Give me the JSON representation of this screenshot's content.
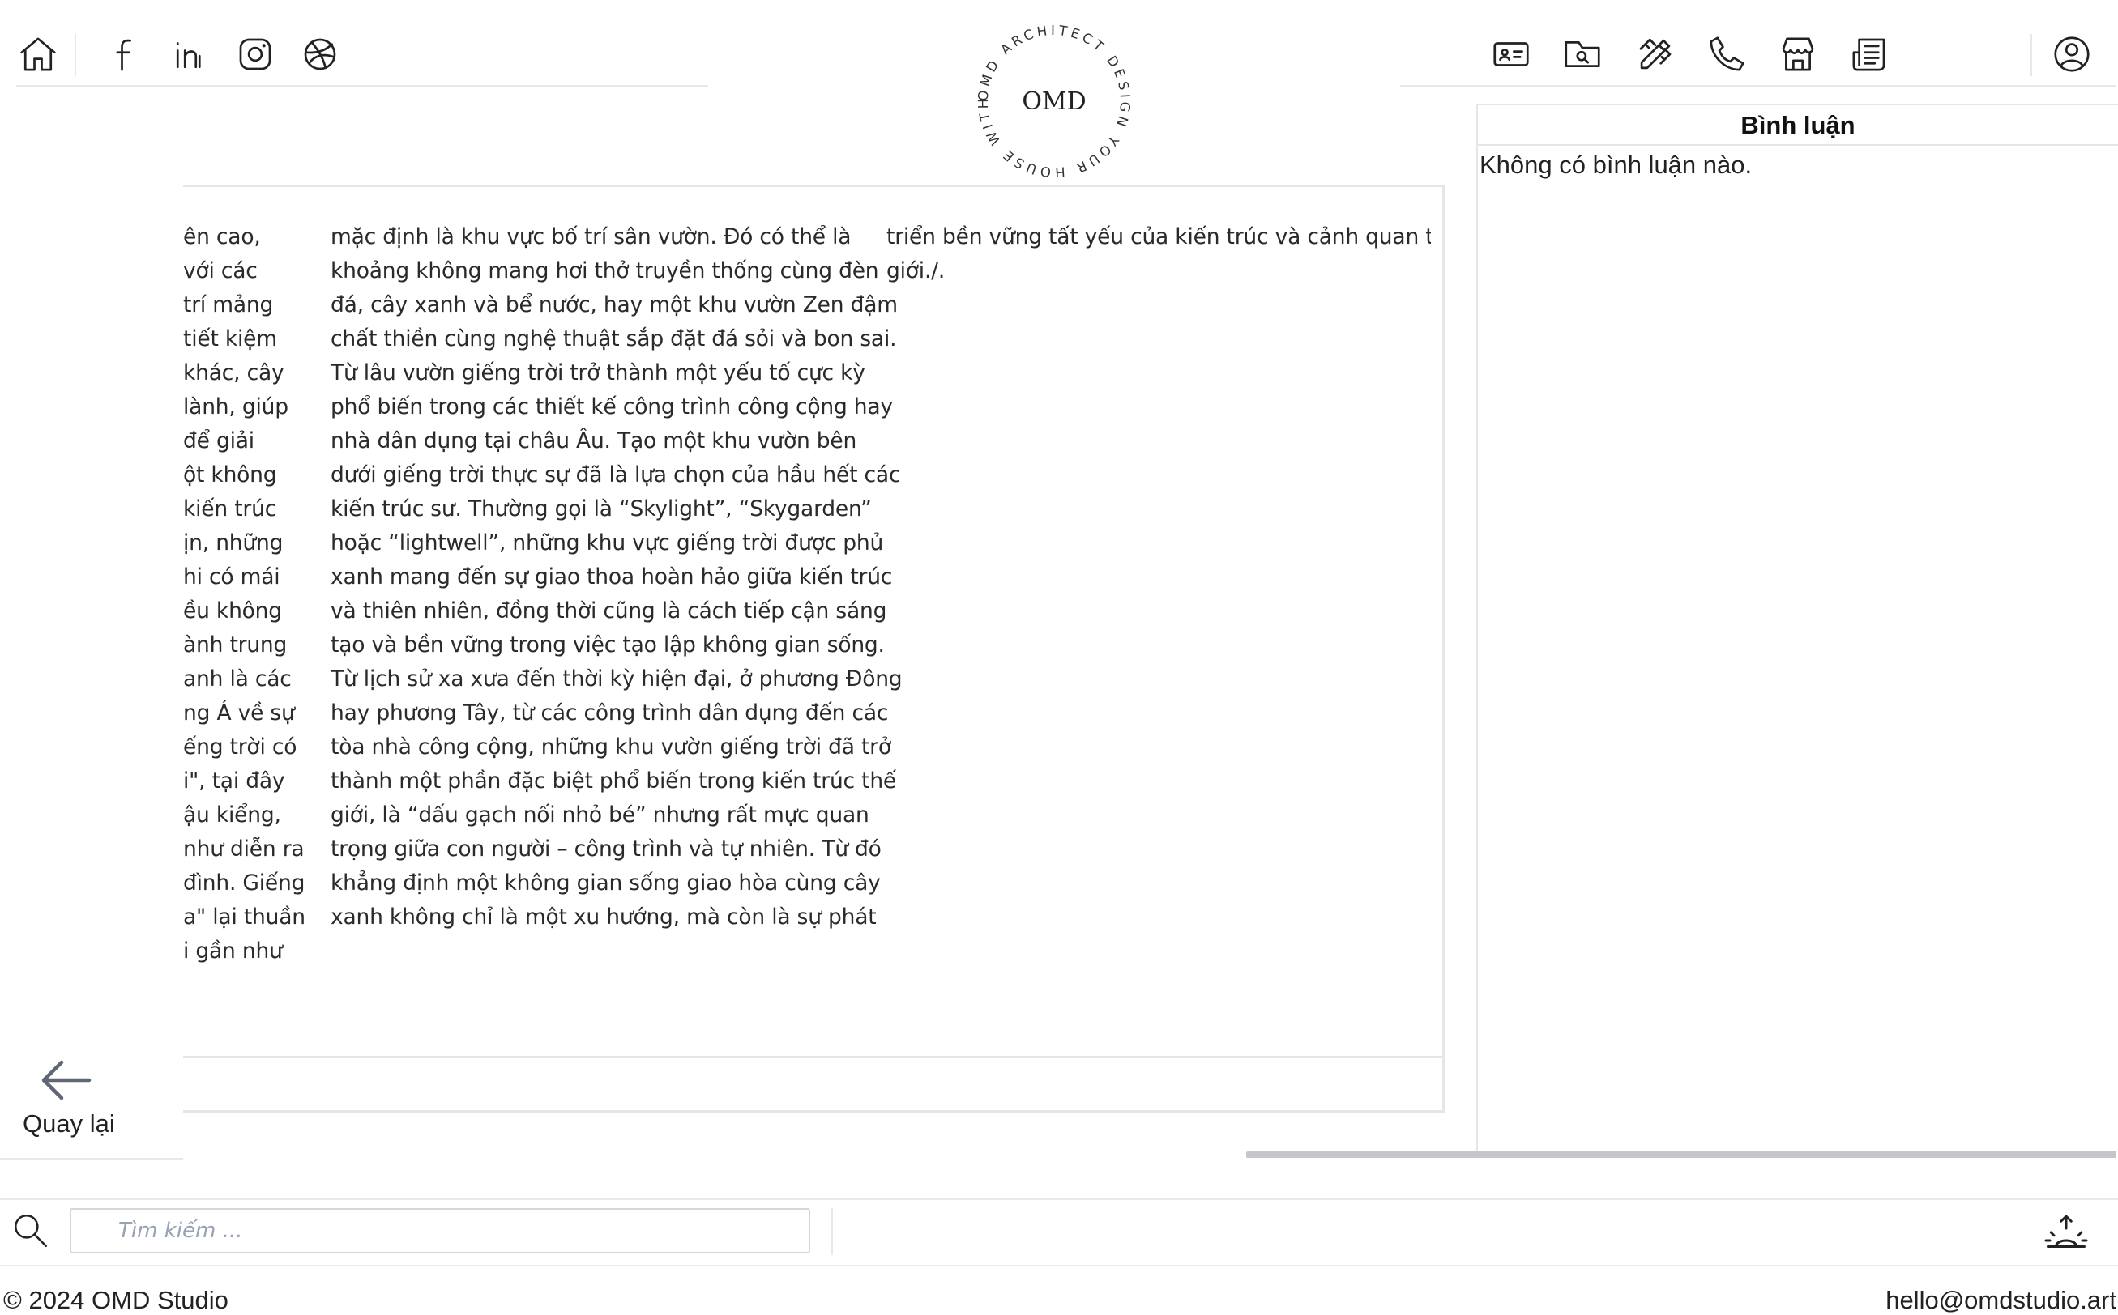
{
  "header": {
    "logo_center_text": "OMD",
    "logo_ring_text": "OMD ARCHITECT DESIGN YOUR HOUSE WITH ",
    "left_icons": [
      "home-icon",
      "facebook-icon",
      "linkedin-icon",
      "instagram-icon",
      "dribbble-icon"
    ],
    "right_icons": [
      "contact-card-icon",
      "folder-search-icon",
      "design-tools-icon",
      "phone-icon",
      "store-icon",
      "news-icon",
      "user-account-icon"
    ]
  },
  "article": {
    "col1_fragments": [
      "ên cao,",
      "với các",
      "trí mảng",
      "tiết kiệm",
      "khác, cây",
      "lành, giúp",
      "để giải",
      "ột không",
      "kiến trúc",
      "ịn, những",
      "hi có mái",
      "ều không",
      "ành trung",
      "anh là các",
      "ng Á về sự",
      "ếng trời có",
      "i\", tại đây",
      "ậu kiểng,",
      "như diễn ra",
      "đình. Giếng",
      "a\" lại thuần",
      "i gần như"
    ],
    "col2_lines": [
      "mặc định là khu vực bố trí sân vườn. Đó có thể là",
      "khoảng không mang hơi thở truyền thống cùng đèn",
      "đá, cây xanh và bể nước, hay một khu vườn Zen đậm",
      "chất thiền cùng nghệ thuật sắp đặt đá sỏi và bon sai.",
      "Từ lâu vườn giếng trời trở thành một yếu tố cực kỳ",
      "phổ biến trong các thiết kế công trình công cộng hay",
      "nhà dân dụng tại châu Âu. Tạo một khu vườn bên",
      "dưới giếng trời thực sự đã là lựa chọn của hầu hết các",
      "kiến trúc sư. Thường gọi là “Skylight”, “Skygarden”",
      "hoặc “lightwell”, những khu vực giếng trời được phủ",
      "xanh mang đến sự giao thoa hoàn hảo giữa kiến trúc",
      "và thiên nhiên, đồng thời cũng là cách tiếp cận sáng",
      "tạo và bền vững trong việc tạo lập không gian sống.",
      "Từ lịch sử xa xưa đến thời kỳ hiện đại, ở phương Đông",
      "hay phương Tây, từ các công trình dân dụng đến các",
      "tòa nhà công cộng, những khu vườn giếng trời đã trở",
      "thành một phần đặc biệt phổ biến trong kiến trúc thế",
      "giới, là “dấu gạch nối nhỏ bé” nhưng rất mực quan",
      "trọng giữa con người – công trình và tự nhiên. Từ đó",
      "khẳng định một không gian sống giao hòa cùng cây",
      "xanh không chỉ là một xu hướng, mà còn là sự phát"
    ],
    "col3_lines": [
      "triển bền vững tất yếu của kiến trúc và cảnh quan thế",
      "giới./."
    ]
  },
  "comments": {
    "title": "Bình luận",
    "empty_text": "Không có bình luận nào."
  },
  "back": {
    "label": "Quay lại"
  },
  "search": {
    "placeholder": "Tìm kiếm ..."
  },
  "footer": {
    "copyright": "© 2024 OMD Studio",
    "email": "hello@omdstudio.art"
  }
}
